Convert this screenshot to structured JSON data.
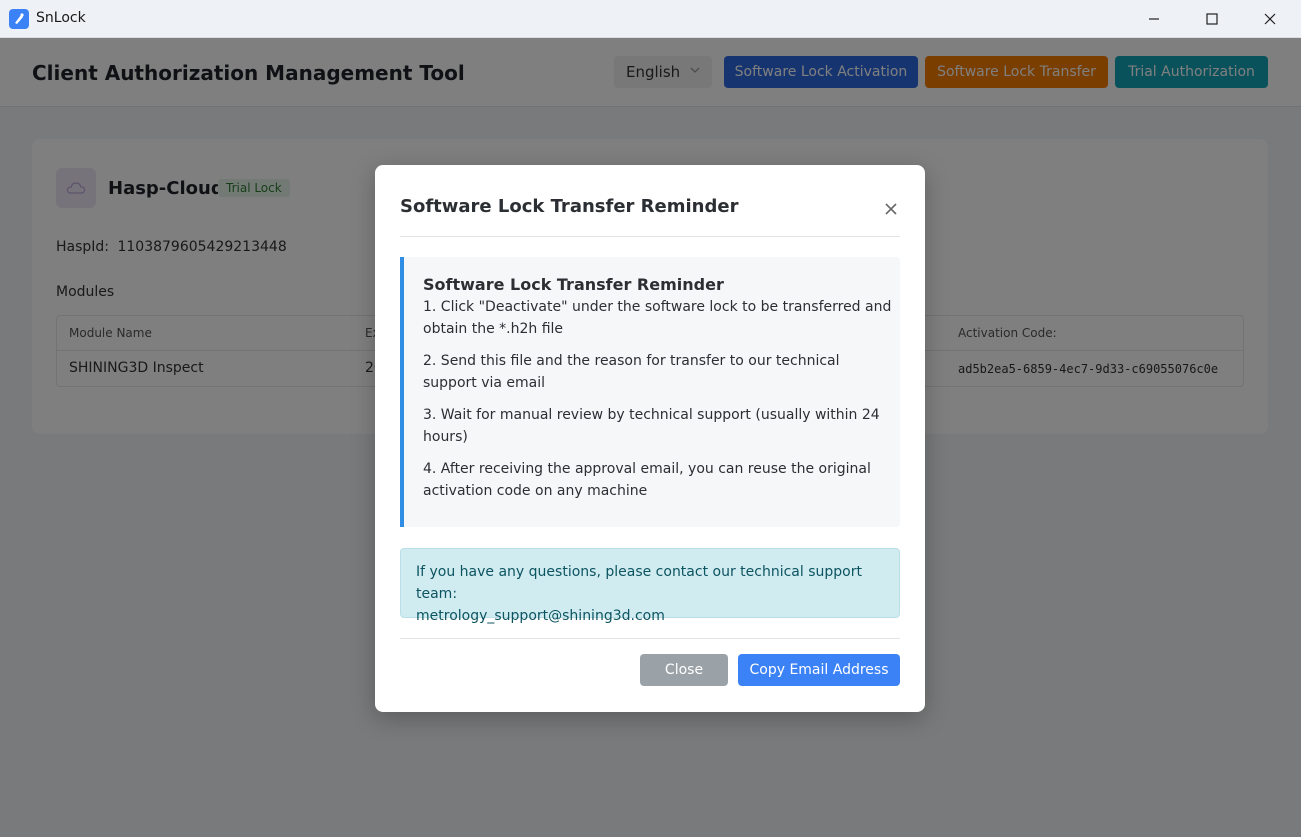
{
  "window": {
    "title": "SnLock",
    "controls": {
      "minimize": "minimize-icon",
      "maximize": "maximize-icon",
      "close": "close-icon"
    }
  },
  "header": {
    "title": "Client Authorization Management Tool",
    "language": {
      "selected": "English"
    },
    "buttons": {
      "activation": "Software Lock Activation",
      "transfer": "Software Lock Transfer",
      "trial": "Trial Authorization"
    }
  },
  "lock": {
    "name": "Hasp-Cloud",
    "badge": "Trial Lock",
    "hasp_id_label": "HaspId:",
    "hasp_id": "1103879605429213448",
    "modules_label": "Modules",
    "table": {
      "columns": [
        "Module Name",
        "Ex",
        "Activation Code:"
      ],
      "rows": [
        {
          "module": "SHINING3D Inspect",
          "expiry": "20",
          "code": "ad5b2ea5-6859-4ec7-9d33-c69055076c0e"
        }
      ]
    }
  },
  "modal": {
    "title": "Software Lock Transfer Reminder",
    "info_heading": "Software Lock Transfer Reminder",
    "steps": [
      "1. Click \"Deactivate\" under the software lock to be transferred and obtain the *.h2h file",
      "2. Send this file and the reason for transfer to our technical support via email",
      "3. Wait for manual review by technical support (usually within 24 hours)",
      "4. After receiving the approval email, you can reuse the original activation code on any machine"
    ],
    "contact_text": "If you have any questions, please contact our technical support team:",
    "contact_email": "metrology_support@shining3d.com",
    "buttons": {
      "close": "Close",
      "copy": "Copy Email Address"
    }
  },
  "colors": {
    "activation": "#2d6ae0",
    "transfer": "#f57c00",
    "trial": "#12a4b8",
    "close_btn": "#9aa2a8",
    "copy_btn": "#3b82f6",
    "info_border": "#2f8de4",
    "contact_bg": "#d1ecf1"
  }
}
